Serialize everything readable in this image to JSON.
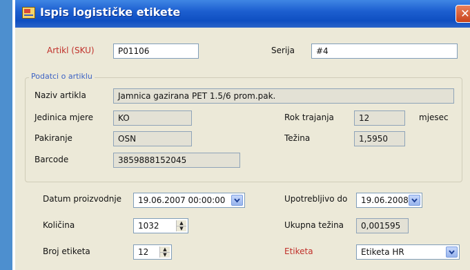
{
  "window": {
    "title": "Ispis logističke etikete",
    "close_symbol": "✕"
  },
  "fields": {
    "artikl_label": "Artikl (SKU)",
    "artikl_value": "P01106",
    "serija_label": "Serija",
    "serija_value": "#4"
  },
  "group": {
    "legend": "Podatci o artiklu",
    "naziv_label": "Naziv artikla",
    "naziv_value": "Jamnica gazirana PET 1.5/6 prom.pak.",
    "jedinica_label": "Jedinica mjere",
    "jedinica_value": "KO",
    "rok_label": "Rok trajanja",
    "rok_value": "12",
    "rok_unit": "mjesec",
    "pakiranje_label": "Pakiranje",
    "pakiranje_value": "OSN",
    "tezina_label": "Težina",
    "tezina_value": "1,5950",
    "barcode_label": "Barcode",
    "barcode_value": "3859888152045"
  },
  "bottom": {
    "datum_label": "Datum proizvodnje",
    "datum_value": "19.06.2007 00:00:00",
    "upotrebljivo_label": "Upotrebljivo do",
    "upotrebljivo_value": "19.06.2008",
    "kolicina_label": "Količina",
    "kolicina_value": "1032",
    "ukupna_label": "Ukupna težina",
    "ukupna_value": "0,001595",
    "broj_label": "Broj etiketa",
    "broj_value": "12",
    "etiketa_label": "Etiketa",
    "etiketa_value": "Etiketa HR"
  },
  "colors": {
    "titlebar": "#1d5fd0",
    "window_bg": "#ece9d8",
    "required_label": "#c0302a",
    "group_legend": "#3c62c4"
  },
  "icons": [
    "app-icon",
    "close-icon",
    "dropdown-arrow-icon",
    "spin-up-icon",
    "spin-down-icon"
  ]
}
